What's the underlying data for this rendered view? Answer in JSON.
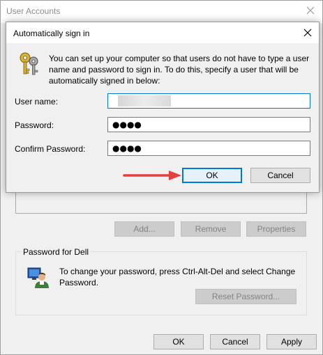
{
  "parent_window": {
    "title": "User Accounts",
    "buttons": {
      "add": "Add...",
      "remove": "Remove",
      "properties": "Properties"
    },
    "password_group": {
      "title": "Password for Dell",
      "text": "To change your password, press Ctrl-Alt-Del and select Change Password.",
      "reset_button": "Reset Password..."
    },
    "footer": {
      "ok": "OK",
      "cancel": "Cancel",
      "apply": "Apply"
    }
  },
  "dialog": {
    "title": "Automatically sign in",
    "description": "You can set up your computer so that users do not have to type a user name and password to sign in. To do this, specify a user that will be automatically signed in below:",
    "fields": {
      "username": {
        "label": "User name:",
        "value": ""
      },
      "password": {
        "label": "Password:",
        "value": "●●●●"
      },
      "confirm": {
        "label": "Confirm Password:",
        "value": "●●●●"
      }
    },
    "ok_button": "OK",
    "cancel_button": "Cancel"
  },
  "colors": {
    "accent": "#0078d7",
    "arrow": "#e53e3e",
    "disabled_text": "#838383"
  },
  "icons": [
    "close-icon",
    "keys-icon",
    "user-password-icon",
    "arrow-annotation"
  ]
}
